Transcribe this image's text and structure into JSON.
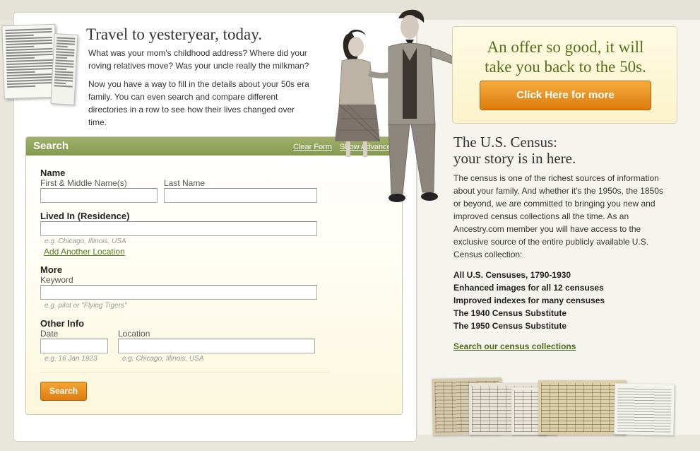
{
  "intro": {
    "title": "Travel to yesteryear, today.",
    "paragraph1": "What was your mom's childhood address? Where did your roving relatives move? Was your uncle really the milkman?",
    "paragraph2": "Now you have a way to fill in the details about your 50s era family. You can even search and compare different directories in a row to see how their lives changed over time."
  },
  "search": {
    "header": "Search",
    "clear_form": "Clear Form",
    "show_advanced": "Show Advanced",
    "name_section": "Name",
    "first_middle_label": "First & Middle Name(s)",
    "last_name_label": "Last Name",
    "first_middle_value": "",
    "last_name_value": "",
    "lived_in_section": "Lived In (Residence)",
    "lived_in_value": "",
    "lived_in_example": "e.g. Chicago, Illinois, USA",
    "add_location": "Add Another Location",
    "more_section": "More",
    "keyword_label": "Keyword",
    "keyword_value": "",
    "keyword_example": "e.g. pilot or \"Flying Tigers\"",
    "other_info_section": "Other Info",
    "date_label": "Date",
    "date_value": "",
    "date_example": "e.g. 16 Jan 1923",
    "location_label": "Location",
    "location_value": "",
    "location_example": "e.g. Chicago, Illinois, USA",
    "submit_label": "Search"
  },
  "offer": {
    "title_line1": "An offer so good, it will",
    "title_line2": "take you back to the 50s.",
    "button_label": "Click Here for more"
  },
  "census": {
    "title_line1": "The U.S. Census:",
    "title_line2": "your story is in here.",
    "description": "The census is one of the richest sources of information about your family. And whether it's the 1950s, the 1850s or beyond, we are committed to bringing you new and improved census collections all the time. As an Ancestry.com member you will have access to the exclusive source of the entire publicly available U.S. Census collection:",
    "items": [
      "All U.S. Censuses, 1790-1930",
      "Enhanced images for all 12 censuses",
      "Improved indexes for many censuses",
      "The 1940 Census Substitute",
      "The 1950 Census Substitute"
    ],
    "link": "Search our census collections"
  },
  "colors": {
    "accent_green": "#849a4e",
    "link_green": "#4d6a17",
    "button_orange": "#dd7d0e",
    "offer_bg": "#fbf3cb"
  }
}
